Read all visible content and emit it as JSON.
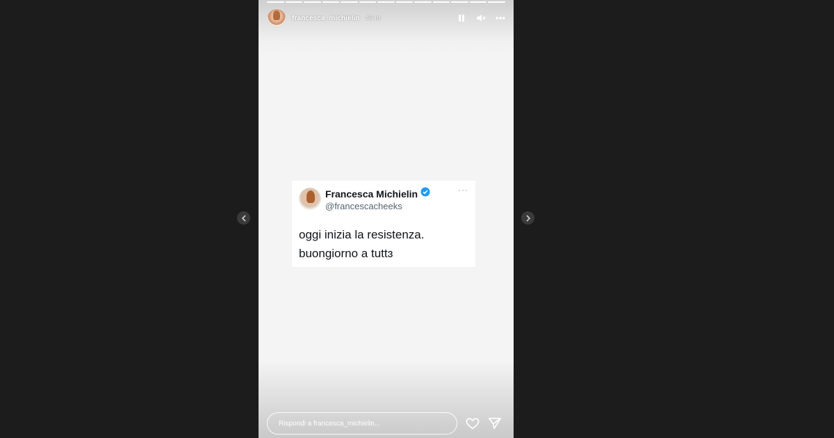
{
  "story": {
    "username": "francesca_michielin",
    "time": "46 m",
    "progress": {
      "segments": 13,
      "completed": 13
    },
    "controls": {
      "pause_icon": "pause-icon",
      "mute_icon": "speaker-muted-icon",
      "more_icon": "more-horizontal-icon"
    }
  },
  "tweet": {
    "display_name": "Francesca Michielin",
    "handle": "@francescacheeks",
    "verified": true,
    "more": "···",
    "lines": [
      "oggi inizia la resistenza.",
      "buongiorno a tuttɜ"
    ]
  },
  "footer": {
    "reply_placeholder": "Rispondi a francesca_michielin...",
    "like_icon": "heart-icon",
    "share_icon": "send-icon"
  },
  "navigation": {
    "prev_icon": "chevron-left-icon",
    "next_icon": "chevron-right-icon"
  },
  "colors": {
    "page_background": "#1c1c1c",
    "verified_blue": "#1d9bf0",
    "tweet_text": "#0f1419",
    "tweet_handle": "#536471"
  }
}
